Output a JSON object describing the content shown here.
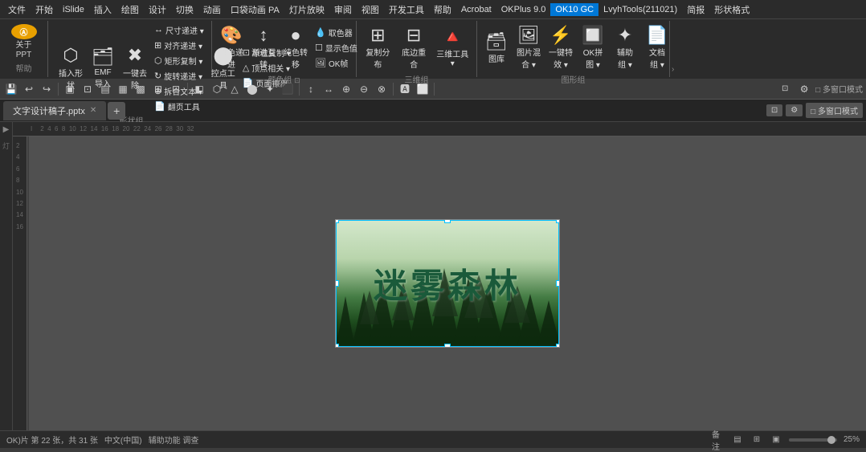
{
  "menubar": {
    "items": [
      "文件",
      "开始",
      "iSlide",
      "插入",
      "绘图",
      "设计",
      "切换",
      "动画",
      "口袋动画 PA",
      "灯片放映",
      "审阅",
      "视图",
      "开发工具",
      "帮助",
      "Acrobat",
      "OKPlus 9.0",
      "OK10 GC",
      "LvyhTools(211021)",
      "简报",
      "形状格式"
    ],
    "active": "OK10 GC"
  },
  "about": {
    "label": "关于\nPPT",
    "sublabel": "帮助"
  },
  "ribbon": {
    "groups": [
      {
        "label": "形状组",
        "items": [
          {
            "icon": "▦",
            "text": "插入形状"
          },
          {
            "icon": "⊡",
            "text": "EMF导入"
          },
          {
            "icon": "✦",
            "text": "一键去除"
          }
        ],
        "smallItems": [
          {
            "icon": "↔",
            "text": "尺寸递进▾"
          },
          {
            "icon": "⊞",
            "text": "对齐递进▾"
          },
          {
            "icon": "⬡",
            "text": "矩形复制▾"
          },
          {
            "icon": "↻",
            "text": "旋转递进▾"
          },
          {
            "icon": "⊕",
            "text": "拆合文本▾"
          },
          {
            "icon": "📄",
            "text": "翻页工具"
          }
        ]
      },
      {
        "label": "颜色组",
        "items": [
          {
            "icon": "🎨",
            "text": "纯色递进"
          },
          {
            "icon": "↕",
            "text": "渐进互转"
          },
          {
            "icon": "●",
            "text": "纯色转移"
          }
        ],
        "smallItems": [
          {
            "icon": "💧",
            "text": "取色器"
          },
          {
            "icon": "☐",
            "text": "显示色值"
          },
          {
            "icon": "🖼",
            "text": "OK帧"
          }
        ]
      },
      {
        "label": "三维组",
        "items": [
          {
            "icon": "⊡",
            "text": "复制分布"
          },
          {
            "icon": "△",
            "text": "底边重合"
          },
          {
            "icon": "🔺",
            "text": "三维工具"
          }
        ]
      },
      {
        "label": "图形组",
        "items": [
          {
            "icon": "⬡",
            "text": "图库"
          },
          {
            "icon": "🖼",
            "text": "图片混合"
          },
          {
            "icon": "⚡",
            "text": "一键特效"
          },
          {
            "icon": "🔲",
            "text": "OK拼图"
          },
          {
            "icon": "✦",
            "text": "辅助组"
          },
          {
            "icon": "📄",
            "text": "文档组"
          }
        ]
      }
    ]
  },
  "toolbar2": {
    "buttons": [
      "⎘",
      "💾",
      "↩",
      "↪",
      "🔍",
      "⊞",
      "⊡",
      "▣",
      "▤",
      "▦",
      "▩",
      "▶",
      "◀",
      "⊕",
      "⊖",
      "⊗",
      "☐",
      "▧",
      "▨",
      "▦",
      "↕",
      "↔",
      "⬡",
      "△",
      "⬤",
      "✦",
      "⬛",
      "🅰",
      "⬜"
    ]
  },
  "tabs": {
    "files": [
      "文字设计稿子.pptx"
    ],
    "active": "文字设计稿子.pptx"
  },
  "ruler": {
    "marks": [
      "2",
      "4",
      "6",
      "8",
      "10",
      "12",
      "14",
      "16",
      "18",
      "20",
      "22",
      "24",
      "26",
      "28",
      "30",
      "32"
    ]
  },
  "slide": {
    "text": "迷雾森林"
  },
  "statusbar": {
    "slide_info": "OK)片 第 22 张，共 31 张",
    "lang": "中文(中国)",
    "accessibility": "辅助功能 调查",
    "notes": "备注",
    "zoom": "25%",
    "view_icons": [
      "normal",
      "slide-sorter",
      "reading"
    ]
  }
}
